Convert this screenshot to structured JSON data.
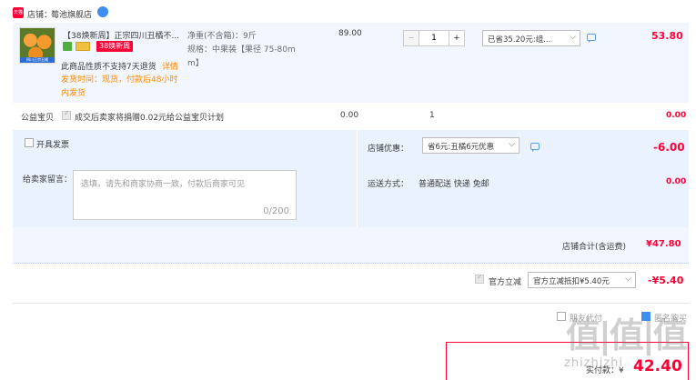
{
  "store": {
    "badge": "天猫",
    "label": "店铺：",
    "name": "莓池旗舰店"
  },
  "item": {
    "thumb_caption": "四川正宗丑橘",
    "title": "【38焕新周】正宗四川丑橘不...",
    "promo_tag": "38焕新周",
    "notice_1": "此商品性质不支持7天退货",
    "notice_link": "详情",
    "ship_prefix": "发货时间：现货，付款后48小时",
    "ship_suffix": "内发货",
    "spec_line1": "净重(不含箱)：9斤",
    "spec_line2": "规格：中果装【果径 75-80m",
    "spec_line3": "m】",
    "unit_price": "89.00",
    "qty_minus": "−",
    "qty": "1",
    "qty_plus": "+",
    "discount_select": "已省35.20元:组...",
    "subtotal": "53.80"
  },
  "charity": {
    "label": "公益宝贝",
    "text": "成交后卖家将捐赠0.02元给公益宝贝计划",
    "price": "0.00",
    "qty": "1",
    "total": "0.00"
  },
  "anon": {
    "label": "开具发票"
  },
  "store_discount": {
    "label": "店铺优惠：",
    "select": "省6元:丑橘6元优惠",
    "value": "-6.00"
  },
  "message": {
    "label": "给卖家留言：",
    "placeholder": "选填，请先和商家协商一致，付款后商家可见",
    "counter": "0/200"
  },
  "shipping": {
    "label": "运送方式：",
    "text": "普通配送 快递 免邮",
    "value": "0.00"
  },
  "store_total": {
    "label": "店铺合计(含运费)",
    "value": "¥47.80"
  },
  "official": {
    "label": "官方立减",
    "select": "官方立减抵扣¥5.40元",
    "value": "-¥5.40"
  },
  "bottom": {
    "agent_label": "朋友代付",
    "invoice_label": "匿名购买",
    "pay_label": "实付款：¥",
    "pay_value": "42.40",
    "watermark": "值|值|值",
    "watermark2": "zhizhizhi"
  },
  "colors": {
    "accent": "#ff0036",
    "panel": "#f2f7ff",
    "panel2": "#eaf2fd",
    "icon_blue": "#3d8ef0"
  }
}
